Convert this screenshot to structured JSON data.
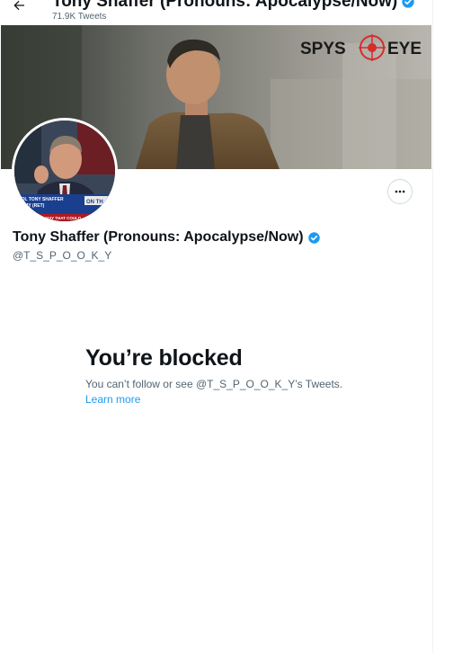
{
  "header": {
    "back_icon": "arrow-left-icon",
    "title": "Tony Shaffer (Pronouns: Apocalypse/Now)",
    "tweet_count": "71.9K Tweets"
  },
  "banner": {
    "logo_left": "SPYS",
    "logo_right": "EYE"
  },
  "avatar": {
    "chyron_line1": "COL TONY SHAFFER",
    "chyron_line2": "ARMY (RET)",
    "chyron_tag": "ON TH",
    "chyron_ticker": "VISITED IN MAY THAT COULD"
  },
  "profile": {
    "name": "Tony Shaffer (Pronouns: Apocalypse/Now)",
    "handle": "@T_S_P_O_O_K_Y",
    "verified_icon": "verified-badge-icon",
    "more_icon": "more-horizontal-icon"
  },
  "blocked": {
    "title": "You’re blocked",
    "message": "You can’t follow or see @T_S_P_O_O_K_Y’s Tweets.",
    "learn_more": "Learn more"
  },
  "colors": {
    "accent": "#1d9bf0",
    "text_primary": "#0f1419",
    "text_secondary": "#536471",
    "logo_red": "#d62d2d"
  }
}
